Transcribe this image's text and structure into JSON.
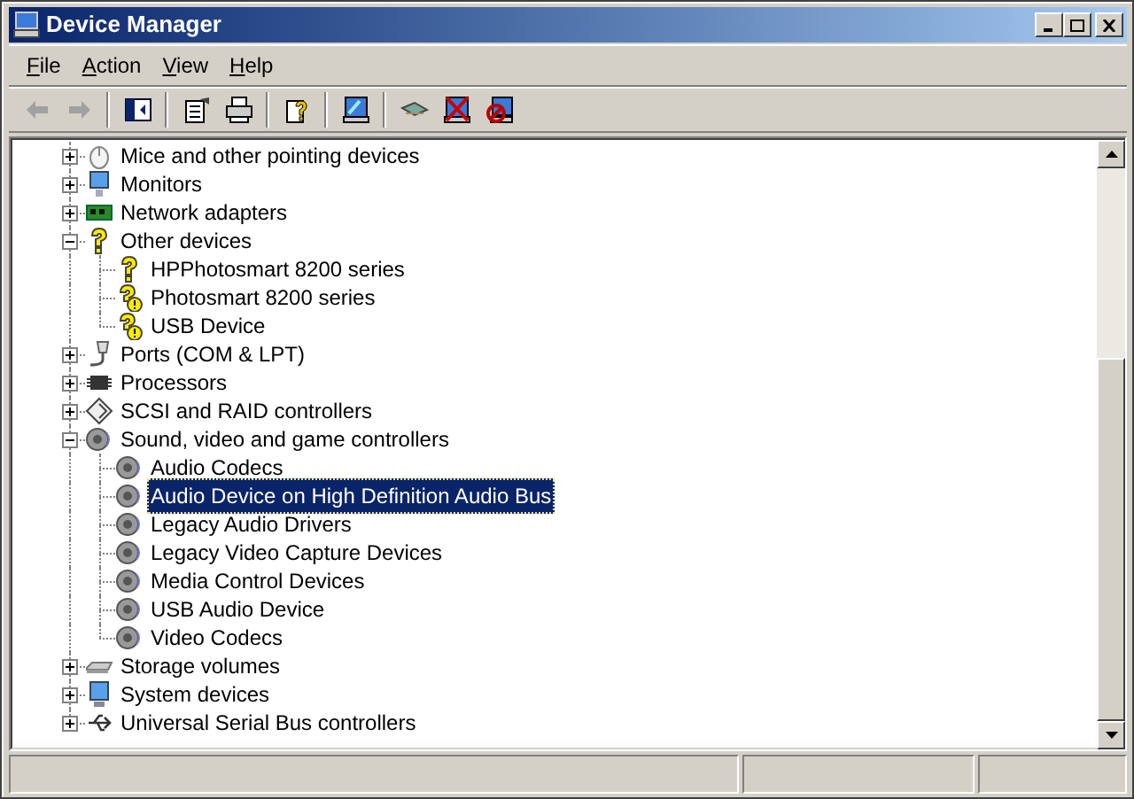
{
  "window": {
    "title": "Device Manager"
  },
  "menu": [
    "File",
    "Action",
    "View",
    "Help"
  ],
  "toolbar": [
    {
      "kind": "back",
      "disabled": true
    },
    {
      "kind": "forward",
      "disabled": true
    },
    {
      "kind": "sep"
    },
    {
      "kind": "tree"
    },
    {
      "kind": "sep"
    },
    {
      "kind": "properties"
    },
    {
      "kind": "print"
    },
    {
      "kind": "sep"
    },
    {
      "kind": "help"
    },
    {
      "kind": "sep"
    },
    {
      "kind": "update"
    },
    {
      "kind": "sep"
    },
    {
      "kind": "scan"
    },
    {
      "kind": "uninstall"
    },
    {
      "kind": "disable"
    }
  ],
  "tree": [
    {
      "label": "Mice and other pointing devices",
      "kind": "mouse",
      "expanded": false
    },
    {
      "label": "Monitors",
      "kind": "monitor",
      "expanded": false
    },
    {
      "label": "Network adapters",
      "kind": "network",
      "expanded": false
    },
    {
      "label": "Other devices",
      "kind": "unknown",
      "expanded": true,
      "children": [
        {
          "label": "HPPhotosmart 8200 series",
          "kind": "unknown",
          "selected": false
        },
        {
          "label": "Photosmart 8200 series",
          "kind": "warning",
          "selected": false
        },
        {
          "label": "USB Device",
          "kind": "warning",
          "selected": false
        }
      ]
    },
    {
      "label": "Ports (COM & LPT)",
      "kind": "port",
      "expanded": false
    },
    {
      "label": "Processors",
      "kind": "chip",
      "expanded": false
    },
    {
      "label": "SCSI and RAID controllers",
      "kind": "scsi",
      "expanded": false
    },
    {
      "label": "Sound, video and game controllers",
      "kind": "sound",
      "expanded": true,
      "children": [
        {
          "label": "Audio Codecs",
          "kind": "sound",
          "selected": false
        },
        {
          "label": "Audio Device on High Definition Audio Bus",
          "kind": "sound",
          "selected": true
        },
        {
          "label": "Legacy Audio Drivers",
          "kind": "sound",
          "selected": false
        },
        {
          "label": "Legacy Video Capture Devices",
          "kind": "sound",
          "selected": false
        },
        {
          "label": "Media Control Devices",
          "kind": "sound",
          "selected": false
        },
        {
          "label": "USB Audio Device",
          "kind": "sound",
          "selected": false
        },
        {
          "label": "Video Codecs",
          "kind": "sound",
          "selected": false
        }
      ]
    },
    {
      "label": "Storage volumes",
      "kind": "drive",
      "expanded": false
    },
    {
      "label": "System devices",
      "kind": "system",
      "expanded": false
    },
    {
      "label": "Universal Serial Bus controllers",
      "kind": "usb",
      "expanded": false
    }
  ]
}
